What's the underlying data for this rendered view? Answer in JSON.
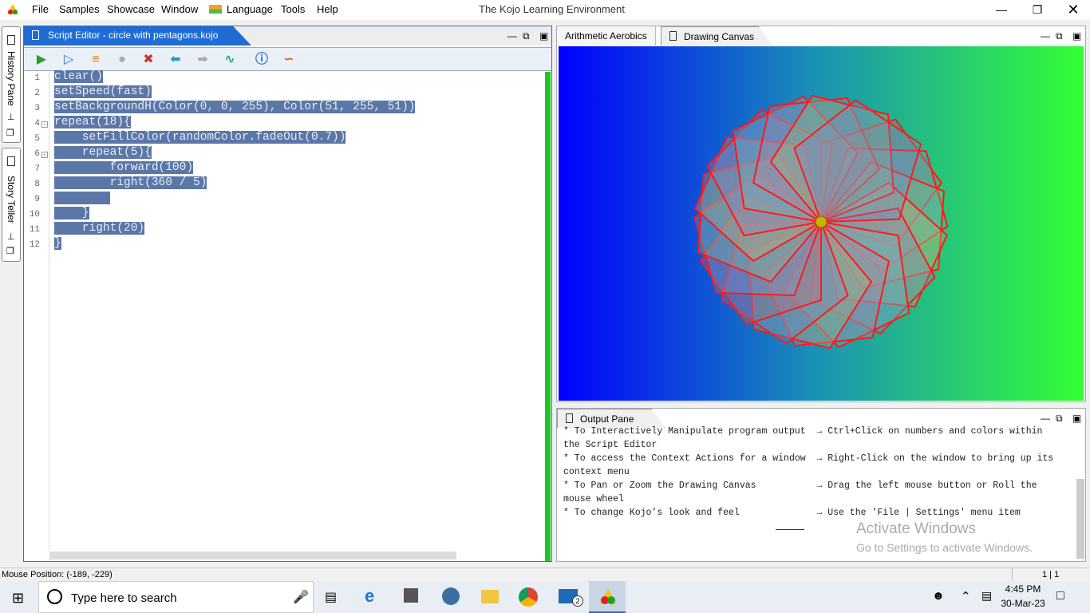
{
  "menubar": {
    "items": [
      "File",
      "Samples",
      "Showcase",
      "Window",
      "Language",
      "Tools",
      "Help"
    ],
    "title": "The Kojo Learning Environment"
  },
  "side": {
    "history": "History Pane",
    "story": "Story Teller"
  },
  "editor": {
    "tab_title": "Script Editor - circle with pentagons.kojo",
    "lines": [
      {
        "n": "1",
        "text": "clear()",
        "fold": ""
      },
      {
        "n": "2",
        "text": "setSpeed(fast)",
        "fold": ""
      },
      {
        "n": "3",
        "text": "setBackgroundH(Color(0, 0, 255), Color(51, 255, 51))",
        "fold": ""
      },
      {
        "n": "4",
        "text": "repeat(18){",
        "fold": "-"
      },
      {
        "n": "5",
        "text": "    setFillColor(randomColor.fadeOut(0.7))",
        "fold": ""
      },
      {
        "n": "6",
        "text": "    repeat(5){",
        "fold": "-"
      },
      {
        "n": "7",
        "text": "        forward(100)",
        "fold": ""
      },
      {
        "n": "8",
        "text": "        right(360 / 5)",
        "fold": ""
      },
      {
        "n": "9",
        "text": "        ",
        "fold": ""
      },
      {
        "n": "10",
        "text": "    }",
        "fold": ""
      },
      {
        "n": "11",
        "text": "    right(20)",
        "fold": ""
      },
      {
        "n": "12",
        "text": "}",
        "fold": ""
      }
    ],
    "toolbar_icons": [
      "run-icon",
      "step-icon",
      "trace-icon",
      "stop-icon",
      "clear-icon",
      "undo-icon",
      "redo-icon",
      "format-icon",
      "help-icon",
      "share-icon"
    ]
  },
  "canvas": {
    "tab1": "Arithmetic Aerobics",
    "tab2": "Drawing Canvas",
    "gradient_from": "#0000ff",
    "gradient_to": "#33ff33",
    "stroke_color": "#ff1a1a"
  },
  "output": {
    "tab": "Output Pane",
    "lines": [
      "* To Interactively Manipulate program output  → Ctrl+Click on numbers and colors within",
      "the Script Editor",
      "* To access the Context Actions for a window  → Right-Click on the window to bring up its",
      "context menu",
      "* To Pan or Zoom the Drawing Canvas           → Drag the left mouse button or Roll the",
      "mouse wheel",
      "* To change Kojo's look and feel              → Use the 'File | Settings' menu item"
    ],
    "activate_title": "Activate Windows",
    "activate_sub": "Go to Settings to activate Windows."
  },
  "status": {
    "mouse": "Mouse Position: (-189, -229)",
    "position": "1 | 1"
  },
  "taskbar": {
    "search_placeholder": "Type here to search",
    "time": "4:45 PM",
    "date": "30-Mar-23",
    "mail_badge": "2"
  }
}
